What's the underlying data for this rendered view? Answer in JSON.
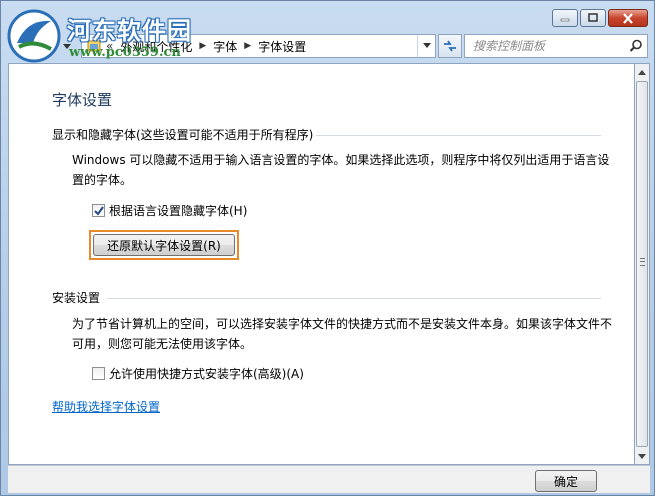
{
  "watermark": {
    "title": "河东软件园",
    "url": "www.pc0359.cn"
  },
  "window": {
    "caption_icons": [
      "minimize-icon",
      "maximize-icon",
      "close-icon"
    ]
  },
  "address_bar": {
    "overflow": "«",
    "segments": [
      "外观和个性化",
      "字体",
      "字体设置"
    ]
  },
  "search": {
    "placeholder": "搜索控制面板"
  },
  "page": {
    "title": "字体设置"
  },
  "section_show_hide": {
    "header": "显示和隐藏字体(这些设置可能不适用于所有程序)",
    "description": "Windows 可以隐藏不适用于输入语言设置的字体。如果选择此选项，则程序中将仅列出适用于语言设置的字体。",
    "checkbox_label": "根据语言设置隐藏字体(H)",
    "checkbox_checked": true,
    "restore_button": "还原默认字体设置(R)",
    "highlight_color": "#e8892c"
  },
  "section_install": {
    "header": "安装设置",
    "description": "为了节省计算机上的空间，可以选择安装字体文件的快捷方式而不是安装文件本身。如果该字体文件不可用，则您可能无法使用该字体。",
    "checkbox_label": "允许使用快捷方式安装字体(高级)(A)",
    "checkbox_checked": false
  },
  "help_link": "帮助我选择字体设置",
  "footer": {
    "ok_button": "确定"
  }
}
